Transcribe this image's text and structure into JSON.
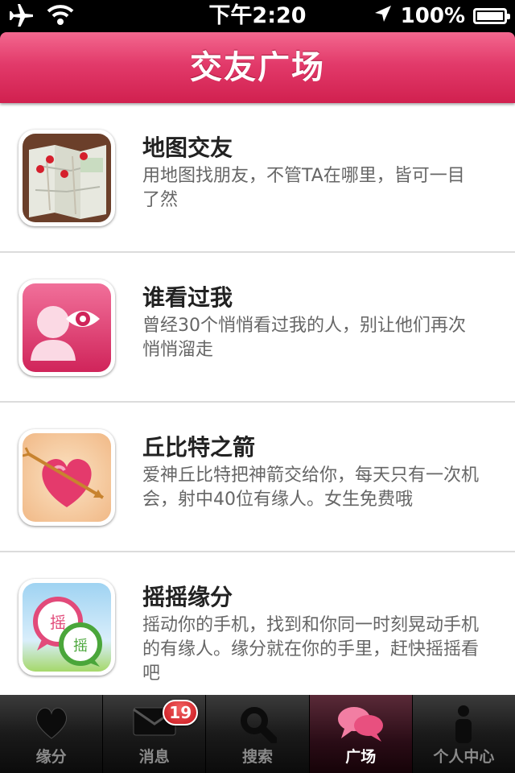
{
  "status_bar": {
    "time": "下午2:20",
    "battery": "100%",
    "battery_level": 1.0,
    "icons": [
      "airplane-icon",
      "wifi-icon",
      "location-arrow-icon",
      "battery-icon"
    ]
  },
  "navbar": {
    "title": "交友广场"
  },
  "items": [
    {
      "title": "地图交友",
      "desc": "用地图找朋友，不管TA在哪里，皆可一目了然",
      "icon": "map-icon"
    },
    {
      "title": "谁看过我",
      "desc": "曾经30个悄悄看过我的人，别让他们再次悄悄溜走",
      "icon": "visitor-eye-icon"
    },
    {
      "title": "丘比特之箭",
      "desc": "爱神丘比特把神箭交给你，每天只有一次机会，射中40位有缘人。女生免费哦",
      "icon": "cupid-heart-icon"
    },
    {
      "title": "摇摇缘分",
      "desc": "摇动你的手机，找到和你同一时刻晃动手机的有缘人。缘分就在你的手里，赶快摇摇看吧",
      "icon": "shake-bubbles-icon"
    }
  ],
  "tabbar": {
    "tabs": [
      {
        "label": "缘分",
        "icon": "heart-icon"
      },
      {
        "label": "消息",
        "icon": "envelope-icon",
        "badge": "19"
      },
      {
        "label": "搜索",
        "icon": "magnifier-icon"
      },
      {
        "label": "广场",
        "icon": "chat-bubbles-icon",
        "active": true
      },
      {
        "label": "个人中心",
        "icon": "person-icon"
      }
    ]
  },
  "colors": {
    "accent": "#e23a6a",
    "nav_dark": "#d1204f",
    "tab_bg": "#1a1a1a",
    "badge": "#d71a22"
  }
}
